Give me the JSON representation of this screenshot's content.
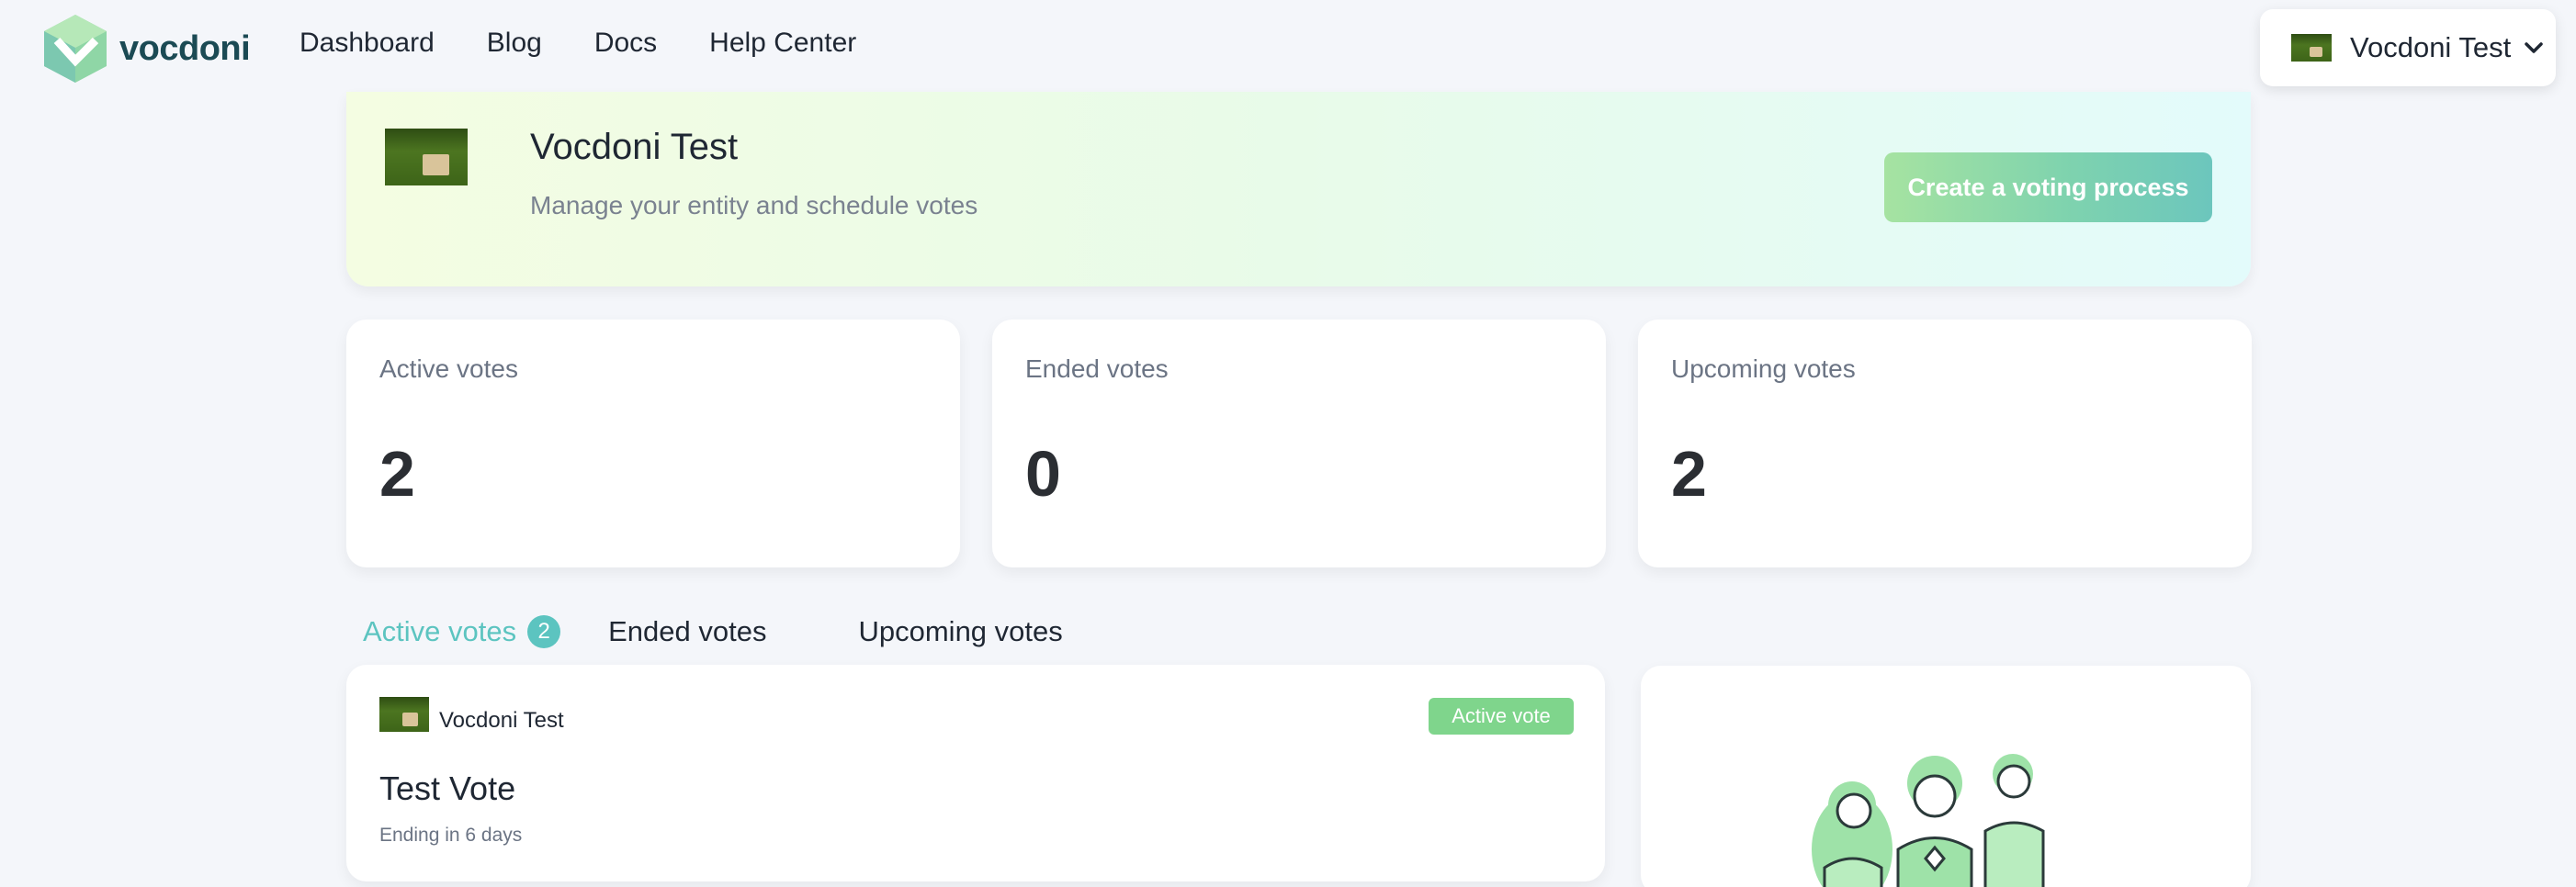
{
  "brand": {
    "name": "vocdoni",
    "logo_icon": "vocdoni-cube-logo",
    "color": "#5cc4c0"
  },
  "nav": {
    "items": [
      "Dashboard",
      "Blog",
      "Docs",
      "Help Center"
    ]
  },
  "account": {
    "name": "Vocdoni Test",
    "avatar": "entity-photo-thumbnail",
    "menu_icon": "chevron-down-icon"
  },
  "banner": {
    "title": "Vocdoni Test",
    "subtitle": "Manage your entity and schedule votes",
    "create_button": "Create a voting process"
  },
  "stats": [
    {
      "label": "Active votes",
      "value": "2"
    },
    {
      "label": "Ended votes",
      "value": "0"
    },
    {
      "label": "Upcoming votes",
      "value": "2"
    }
  ],
  "tabs": {
    "active": {
      "label": "Active votes",
      "count": "2"
    },
    "ended": {
      "label": "Ended votes"
    },
    "upcoming": {
      "label": "Upcoming votes"
    }
  },
  "vote": {
    "entity": "Vocdoni Test",
    "status": "Active vote",
    "title": "Test Vote",
    "ending": "Ending in 6 days"
  },
  "colors": {
    "accent": "#5cc4c0",
    "status_green": "#7fd58c",
    "background": "#f4f6fa"
  }
}
